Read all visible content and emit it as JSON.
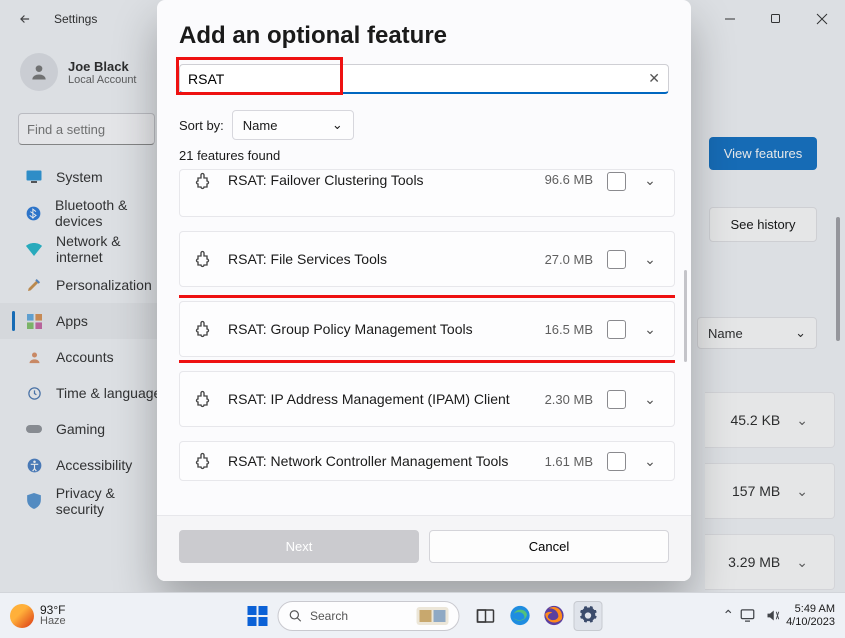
{
  "titlebar": {
    "title": "Settings"
  },
  "user": {
    "name": "Joe Black",
    "account_type": "Local Account"
  },
  "find": {
    "placeholder": "Find a setting"
  },
  "nav": {
    "items": [
      {
        "label": "System"
      },
      {
        "label": "Bluetooth & devices"
      },
      {
        "label": "Network & internet"
      },
      {
        "label": "Personalization"
      },
      {
        "label": "Apps"
      },
      {
        "label": "Accounts"
      },
      {
        "label": "Time & language"
      },
      {
        "label": "Gaming"
      },
      {
        "label": "Accessibility"
      },
      {
        "label": "Privacy & security"
      }
    ]
  },
  "background": {
    "view_features": "View features",
    "see_history": "See history",
    "sort_label": "Name",
    "rows": [
      {
        "size": "45.2 KB"
      },
      {
        "size": "157 MB"
      },
      {
        "size": "3.29 MB"
      }
    ]
  },
  "modal": {
    "title": "Add an optional feature",
    "search_value": "RSAT",
    "sort_label": "Sort by:",
    "sort_value": "Name",
    "count_text": "21 features found",
    "features": [
      {
        "name": "RSAT: Failover Clustering Tools",
        "size": "96.6 MB"
      },
      {
        "name": "RSAT: File Services Tools",
        "size": "27.0 MB"
      },
      {
        "name": "RSAT: Group Policy Management Tools",
        "size": "16.5 MB"
      },
      {
        "name": "RSAT: IP Address Management (IPAM) Client",
        "size": "2.30 MB"
      },
      {
        "name": "RSAT: Network Controller Management Tools",
        "size": "1.61 MB"
      }
    ],
    "next": "Next",
    "cancel": "Cancel"
  },
  "taskbar": {
    "temp": "93°F",
    "desc": "Haze",
    "search": "Search",
    "time": "5:49 AM",
    "date": "4/10/2023"
  },
  "colors": {
    "accent": "#0067c0",
    "highlight": "#e11"
  }
}
